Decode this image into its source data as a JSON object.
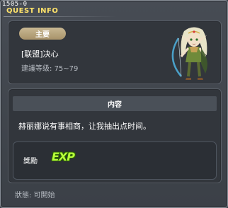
{
  "window": {
    "quest_id": "1505-0",
    "title": "QUEST INFO"
  },
  "quest": {
    "category_tag": "主要",
    "name": "[联盟]决心",
    "level_label": "建議等级:",
    "level_range": "75~79",
    "character_name": "npc-elf-archer"
  },
  "content": {
    "header": "内容",
    "description": "赫丽娜说有事相商，让我抽出点时间。"
  },
  "reward": {
    "label": "獎勵",
    "exp_icon": "EXP"
  },
  "status": {
    "text": "狀態: 可開始"
  },
  "colors": {
    "title": "#ffe36a",
    "tag": "#b8a37c",
    "exp": "#b6ff3a"
  }
}
